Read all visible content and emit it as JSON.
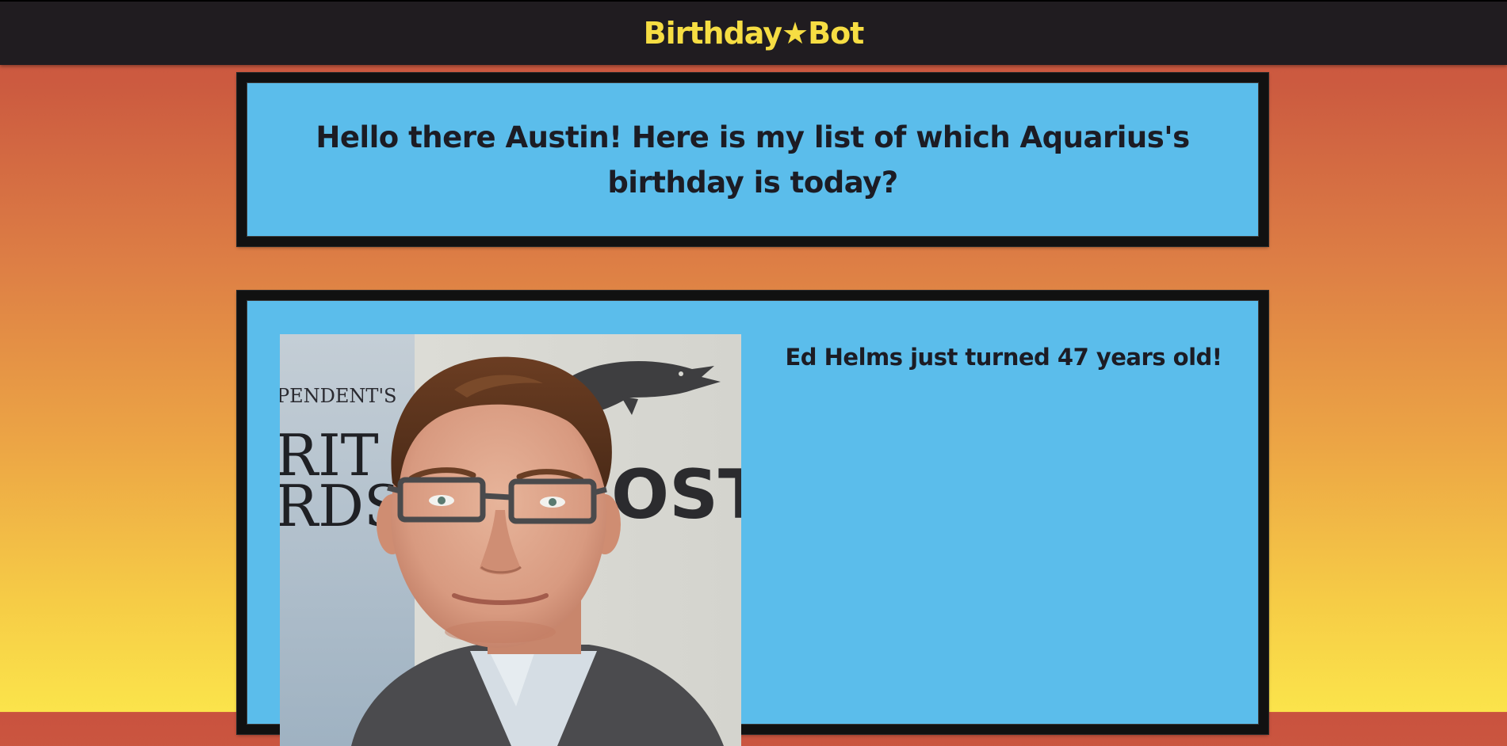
{
  "header": {
    "brand": "Birthday★Bot",
    "brand_color": "#f6dd43",
    "background_color": "#201c20"
  },
  "greeting": {
    "text": "Hello there Austin! Here is my list of which Aquarius's birthday is today?"
  },
  "celebrity": {
    "caption": "Ed Helms just turned 47 years old!",
    "photo_alt": "Ed Helms",
    "backdrop_text_left": [
      "PENDENT'S",
      "RIT",
      "RDS"
    ],
    "backdrop_text_right": "OST"
  },
  "colors": {
    "card_background": "#5bbdeb",
    "card_border": "#111111",
    "text": "#1c1c24",
    "page_gradient_top": "#c9523f",
    "page_gradient_bottom": "#fbe44b"
  }
}
